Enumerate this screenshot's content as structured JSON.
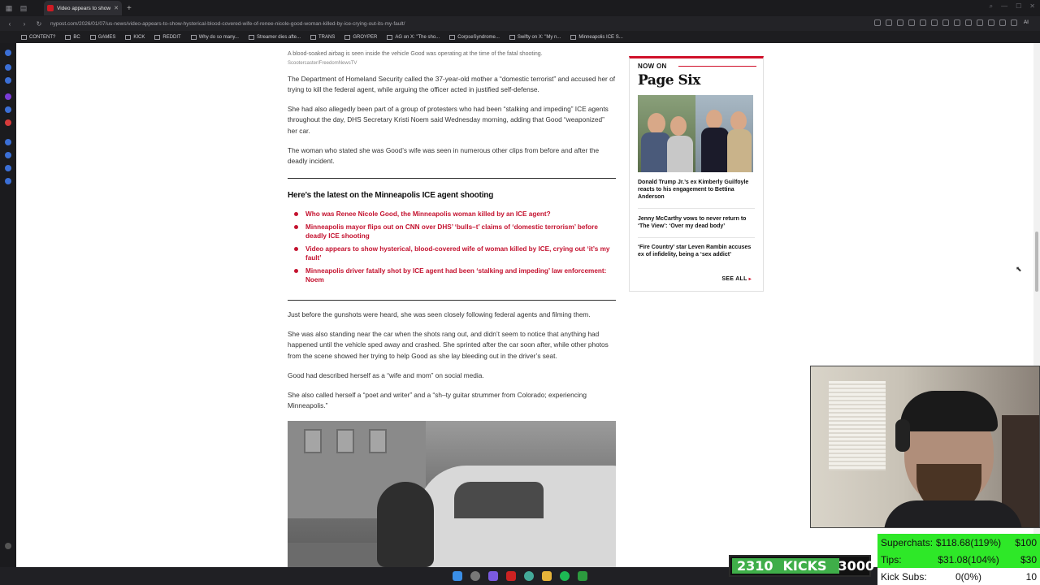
{
  "browser": {
    "active_tab_title": "Video appears to show hy...",
    "url": "nypost.com/2026/01/07/us-news/video-appears-to-show-hysterical-blood-covered-wife-of-renee-nicole-good-woman-killed-by-ice-crying-out-its-my-fault/",
    "ai_label": "AI",
    "bookmarks": [
      "CONTENT?",
      "BC",
      "GAMES",
      "KICK",
      "REDDIT",
      "Why do so many...",
      "Streamer dies afte...",
      "TRANS",
      "GROYPER",
      "AG on X: \"The sho...",
      "CorpseSyndrome...",
      "Swifty on X: \"My n...",
      "Minneapolis ICE S..."
    ]
  },
  "article": {
    "caption": "A blood-soaked airbag is seen inside the vehicle Good was operating at the time of the fatal shooting.",
    "credit": "Scootercaster/FreedomNewsTV",
    "p1": "The Department of Homeland Security called the 37-year-old mother a “domestic terrorist” and accused her of trying to kill the federal agent, while arguing the officer acted in justified self-defense.",
    "p2": "She had also allegedly been part of a group of protesters who had been “stalking and impeding” ICE agents throughout the day, DHS Secretary Kristi Noem said Wednesday morning, adding that Good “weaponized” her car.",
    "p3": "The woman who stated she was Good’s wife was seen in numerous other clips from before and after the deadly incident.",
    "latest_heading": "Here’s the latest on the Minneapolis ICE agent shooting",
    "latest_links": [
      "Who was Renee Nicole Good, the Minneapolis woman killed by an ICE agent?",
      "Minneapolis mayor flips out on CNN over DHS’ ‘bulls–t’ claims of ‘domestic terrorism’ before deadly ICE shooting",
      "Video appears to show hysterical, blood-covered wife of woman killed by ICE, crying out ‘it’s my fault’",
      "Minneapolis driver fatally shot by ICE agent had been ‘stalking and impeding’ law enforcement: Noem"
    ],
    "p4": "Just before the gunshots were heard, she was seen closely following federal agents and filming them.",
    "p5": "She was also standing near the car when the shots rang out, and didn’t seem to notice that anything had happened until the vehicle sped away and crashed. She sprinted after the car soon after, while other photos from the scene showed her trying to help Good as she lay bleeding out in the driver’s seat.",
    "p6": "Good had described herself as a “wife and mom” on social media.",
    "p7": "She also called herself a “poet and writer” and a “sh–ty guitar strummer from Colorado; experiencing Minneapolis.”"
  },
  "widget": {
    "now_on": "NOW ON",
    "brand": "Page Six",
    "stories": [
      "Donald Trump Jr.’s ex Kimberly Guilfoyle reacts to his engagement to Bettina Anderson",
      "Jenny McCarthy vows to never return to ‘The View’: ‘Over my dead body’",
      "‘Fire Country’ star Leven Rambin accuses ex of infidelity, being a ‘sex addict’"
    ],
    "see_all": "SEE ALL"
  },
  "overlay": {
    "kicks_current": "2310",
    "kicks_label": "KICKS",
    "kicks_goal": "3000",
    "kicks_progress": 0.77,
    "goals": [
      {
        "label": "Superchats:",
        "value": "$118.68(119%)",
        "goal": "$100",
        "progress": 1.0
      },
      {
        "label": "Tips:",
        "value": "$31.08(104%)",
        "goal": "$30",
        "progress": 1.0
      },
      {
        "label": "Kick Subs:",
        "value": "0(0%)",
        "goal": "10",
        "progress": 0.0
      }
    ]
  },
  "colors": {
    "accent_red": "#c4122f",
    "pagesix_red": "#d0102a",
    "kicks_green": "#3fae49",
    "goal_green": "#2ee828"
  }
}
